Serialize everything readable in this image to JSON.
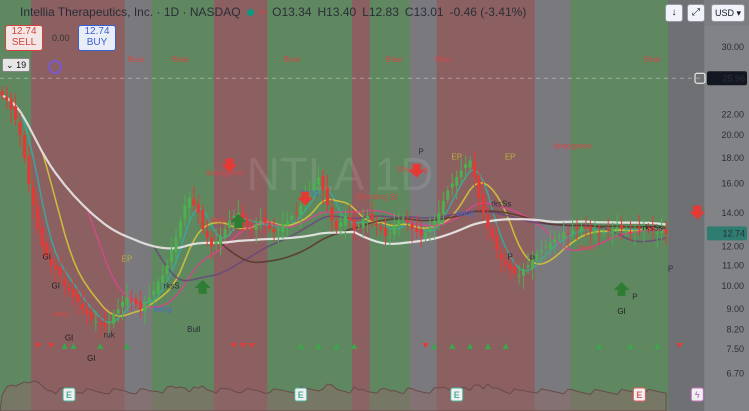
{
  "header": {
    "symbol_title": "Intellia Therapeutics, Inc. · 1D · NASDAQ",
    "ohlc_open": "O13.34",
    "ohlc_high": "H13.40",
    "ohlc_low": "L12.83",
    "ohlc_close": "C13.01",
    "ohlc_change": "-0.46 (-3.41%)",
    "sell_price": "12.74",
    "sell_label": "SELL",
    "buy_price": "12.74",
    "buy_label": "BUY",
    "spread": "0.00",
    "replay_badge": "19",
    "currency": "USD"
  },
  "colors": {
    "band_bear": "#8c5f60",
    "band_bull": "#5f8760",
    "band_neutral": "#7a7a7e",
    "candle_up": "#4caf50",
    "candle_down": "#e53935",
    "price_tag": "#2f7d71"
  },
  "chart_data": {
    "type": "line",
    "title": "",
    "y_scale": "log",
    "ylim": [
      6.5,
      33.0
    ],
    "y_ticks": [
      30.0,
      26.0,
      22.0,
      20.0,
      18.0,
      16.0,
      14.0,
      12.0,
      11.0,
      10.0,
      9.0,
      8.2,
      7.5,
      6.7
    ],
    "y_tick_labels": [
      "30.00",
      "26.00",
      "22.00",
      "20.00",
      "18.00",
      "16.00",
      "14.00",
      "12.00",
      "11.00",
      "10.00",
      "9.00",
      "8.20",
      "7.50",
      "6.70"
    ],
    "crosshair_label": "25.96",
    "crosshair_value": 25.96,
    "last_price_label": "12.74",
    "last_price": 12.74,
    "bar_count": 150,
    "close": [
      24.0,
      23.5,
      22.5,
      21.5,
      20.0,
      18.0,
      16.0,
      14.5,
      13.0,
      12.0,
      11.5,
      11.0,
      10.8,
      10.5,
      10.0,
      9.8,
      9.5,
      9.3,
      9.0,
      8.8,
      8.6,
      8.5,
      8.4,
      8.3,
      8.5,
      8.8,
      9.0,
      9.3,
      9.5,
      9.4,
      9.2,
      9.0,
      9.3,
      9.5,
      9.8,
      10.2,
      10.5,
      11.0,
      11.8,
      12.5,
      13.5,
      14.5,
      15.0,
      14.5,
      14.0,
      13.0,
      12.5,
      12.0,
      12.3,
      12.6,
      13.0,
      13.5,
      13.8,
      14.0,
      13.5,
      13.2,
      13.0,
      13.3,
      13.5,
      13.4,
      13.0,
      12.8,
      13.0,
      13.3,
      13.5,
      13.8,
      14.0,
      14.5,
      15.0,
      15.5,
      16.0,
      16.5,
      15.5,
      14.5,
      13.5,
      13.0,
      13.4,
      13.8,
      13.5,
      13.0,
      13.2,
      13.6,
      13.8,
      13.5,
      13.2,
      13.0,
      12.6,
      12.8,
      13.2,
      13.5,
      13.7,
      13.4,
      13.0,
      12.8,
      12.6,
      12.8,
      13.1,
      13.5,
      14.0,
      14.8,
      15.5,
      16.0,
      16.5,
      17.0,
      17.5,
      17.8,
      16.5,
      15.0,
      14.0,
      13.0,
      12.5,
      11.8,
      11.3,
      11.0,
      10.8,
      10.6,
      10.5,
      10.8,
      11.0,
      11.3,
      11.6,
      11.8,
      12.0,
      12.2,
      12.4,
      12.6,
      12.8,
      12.7,
      12.9,
      13.0,
      13.1,
      13.0,
      12.9,
      12.8,
      12.7,
      12.8,
      12.9,
      13.0,
      13.1,
      13.0,
      12.9,
      12.8,
      12.9,
      13.0,
      13.1,
      13.0,
      12.9,
      12.8,
      12.9,
      12.74
    ],
    "series": [
      {
        "name": "",
        "color": "#3aa8a0",
        "period": 5
      },
      {
        "name": "",
        "color": "#d1c43a",
        "period": 10
      },
      {
        "name": "",
        "color": "#d24a8a",
        "period": 20
      },
      {
        "name": "",
        "color": "#6a4a7a",
        "period": 35
      },
      {
        "name": "",
        "color": "#5a3a2e",
        "period": 50
      },
      {
        "name": "",
        "color": "#ececec",
        "period": 80
      }
    ],
    "bands": [
      {
        "from": 0,
        "to": 7,
        "kind": "bull"
      },
      {
        "from": 7,
        "to": 28,
        "kind": "bear"
      },
      {
        "from": 28,
        "to": 34,
        "kind": "neutral"
      },
      {
        "from": 34,
        "to": 48,
        "kind": "bull"
      },
      {
        "from": 48,
        "to": 60,
        "kind": "bear"
      },
      {
        "from": 60,
        "to": 79,
        "kind": "bull"
      },
      {
        "from": 79,
        "to": 83,
        "kind": "bear"
      },
      {
        "from": 83,
        "to": 92,
        "kind": "bull"
      },
      {
        "from": 92,
        "to": 98,
        "kind": "neutral"
      },
      {
        "from": 98,
        "to": 120,
        "kind": "bear"
      },
      {
        "from": 120,
        "to": 128,
        "kind": "neutral"
      },
      {
        "from": 128,
        "to": 150,
        "kind": "bull"
      }
    ],
    "annotations": [
      {
        "text": "Bear",
        "bar": 30,
        "price": 28.0,
        "color": "#d04a4a"
      },
      {
        "text": "Bear",
        "bar": 40,
        "price": 28.0,
        "color": "#d04a4a"
      },
      {
        "text": "Bear",
        "bar": 65,
        "price": 28.0,
        "color": "#d04a4a"
      },
      {
        "text": "Bear",
        "bar": 88,
        "price": 28.0,
        "color": "#d04a4a"
      },
      {
        "text": "Bear",
        "bar": 99,
        "price": 28.0,
        "color": "#d04a4a"
      },
      {
        "text": "Bear",
        "bar": 146,
        "price": 28.0,
        "color": "#d04a4a"
      },
      {
        "text": "deepgreen",
        "bar": 128,
        "price": 18.8,
        "color": "#d04a4a"
      },
      {
        "text": "deepgreen",
        "bar": 50,
        "price": 16.6,
        "color": "#d04a4a"
      },
      {
        "text": "Shooting",
        "bar": 92,
        "price": 16.9,
        "color": "#d04a4a"
      },
      {
        "text": "Shooting St",
        "bar": 84,
        "price": 14.9,
        "color": "#d04a4a"
      },
      {
        "text": "EP",
        "bar": 28,
        "price": 11.2,
        "color": "#b8b040"
      },
      {
        "text": "EP",
        "bar": 102,
        "price": 17.9,
        "color": "#b8b040"
      },
      {
        "text": "EP",
        "bar": 114,
        "price": 17.9,
        "color": "#b8b040"
      },
      {
        "text": "rksS",
        "bar": 38,
        "price": 9.9,
        "color": "#2a2e39"
      },
      {
        "text": "rksSs",
        "bar": 112,
        "price": 14.4,
        "color": "#2a2e39"
      },
      {
        "text": "bang",
        "bar": 36,
        "price": 8.9,
        "color": "#4a6bd1"
      },
      {
        "text": "bang",
        "bar": 69,
        "price": 15.2,
        "color": "#4a6bd1"
      },
      {
        "text": "bang",
        "bar": 104,
        "price": 13.8,
        "color": "#4a6bd1"
      },
      {
        "text": "GI",
        "bar": 10,
        "price": 11.3,
        "color": "#1f1f1f"
      },
      {
        "text": "GI",
        "bar": 12,
        "price": 9.9,
        "color": "#1f1f1f"
      },
      {
        "text": "GI",
        "bar": 15,
        "price": 7.8,
        "color": "#1f1f1f"
      },
      {
        "text": "GI",
        "bar": 20,
        "price": 7.1,
        "color": "#1f1f1f"
      },
      {
        "text": "GI",
        "bar": 139,
        "price": 8.8,
        "color": "#1f1f1f"
      },
      {
        "text": "Bull",
        "bar": 43,
        "price": 8.1,
        "color": "#2a2e39"
      },
      {
        "text": "P",
        "bar": 94,
        "price": 18.3,
        "color": "#2a2e39"
      },
      {
        "text": "P",
        "bar": 114,
        "price": 11.3,
        "color": "#2a2e39"
      },
      {
        "text": "P",
        "bar": 119,
        "price": 11.2,
        "color": "#2a2e39"
      },
      {
        "text": "P",
        "bar": 142,
        "price": 9.4,
        "color": "#2a2e39"
      },
      {
        "text": "P",
        "bar": 150,
        "price": 10.7,
        "color": "#2a2e39"
      },
      {
        "text": "deep",
        "bar": 13,
        "price": 8.7,
        "color": "#d04a4a"
      },
      {
        "text": "deep",
        "bar": 48,
        "price": 13.4,
        "color": "#d04a4a"
      },
      {
        "text": "deep",
        "bar": 131,
        "price": 11.8,
        "color": "#d04a4a"
      },
      {
        "text": "ruk",
        "bar": 24,
        "price": 7.9,
        "color": "#2a2e39"
      },
      {
        "text": "rksSs",
        "bar": 146,
        "price": 12.9,
        "color": "#2a2e39"
      }
    ],
    "arrows": [
      {
        "bar": 51,
        "price": 17.0,
        "dir": "down",
        "color": "#e53935"
      },
      {
        "bar": 68,
        "price": 14.6,
        "dir": "down",
        "color": "#e53935"
      },
      {
        "bar": 156,
        "price": 13.7,
        "dir": "down",
        "color": "#e53935"
      },
      {
        "bar": 45,
        "price": 10.2,
        "dir": "up",
        "color": "#2e7d32"
      },
      {
        "bar": 53,
        "price": 13.8,
        "dir": "up",
        "color": "#2e7d32"
      },
      {
        "bar": 139,
        "price": 10.1,
        "dir": "up",
        "color": "#2e7d32"
      },
      {
        "bar": 93,
        "price": 16.6,
        "dir": "down",
        "color": "#e53935"
      }
    ],
    "bottom_markers": [
      {
        "bar": 8,
        "dir": "down"
      },
      {
        "bar": 11,
        "dir": "down"
      },
      {
        "bar": 14,
        "dir": "up"
      },
      {
        "bar": 16,
        "dir": "up"
      },
      {
        "bar": 22,
        "dir": "up"
      },
      {
        "bar": 28,
        "dir": "up"
      },
      {
        "bar": 52,
        "dir": "down"
      },
      {
        "bar": 54,
        "dir": "down"
      },
      {
        "bar": 56,
        "dir": "down"
      },
      {
        "bar": 67,
        "dir": "up"
      },
      {
        "bar": 71,
        "dir": "up"
      },
      {
        "bar": 75,
        "dir": "up"
      },
      {
        "bar": 79,
        "dir": "up"
      },
      {
        "bar": 95,
        "dir": "down"
      },
      {
        "bar": 97,
        "dir": "up"
      },
      {
        "bar": 101,
        "dir": "up"
      },
      {
        "bar": 105,
        "dir": "up"
      },
      {
        "bar": 109,
        "dir": "up"
      },
      {
        "bar": 113,
        "dir": "up"
      },
      {
        "bar": 134,
        "dir": "up"
      },
      {
        "bar": 141,
        "dir": "up"
      },
      {
        "bar": 147,
        "dir": "up"
      },
      {
        "bar": 152,
        "dir": "down"
      }
    ],
    "event_markers": [
      {
        "bar": 15,
        "letter": "E",
        "color": "#4caf9a"
      },
      {
        "bar": 67,
        "letter": "E",
        "color": "#4caf9a"
      },
      {
        "bar": 102,
        "letter": "E",
        "color": "#4caf9a"
      },
      {
        "bar": 143,
        "letter": "E",
        "color": "#e06060"
      },
      {
        "bar": 156,
        "letter": "ϟ",
        "color": "#c070c0"
      }
    ],
    "watermark": "NTLA 1D"
  }
}
